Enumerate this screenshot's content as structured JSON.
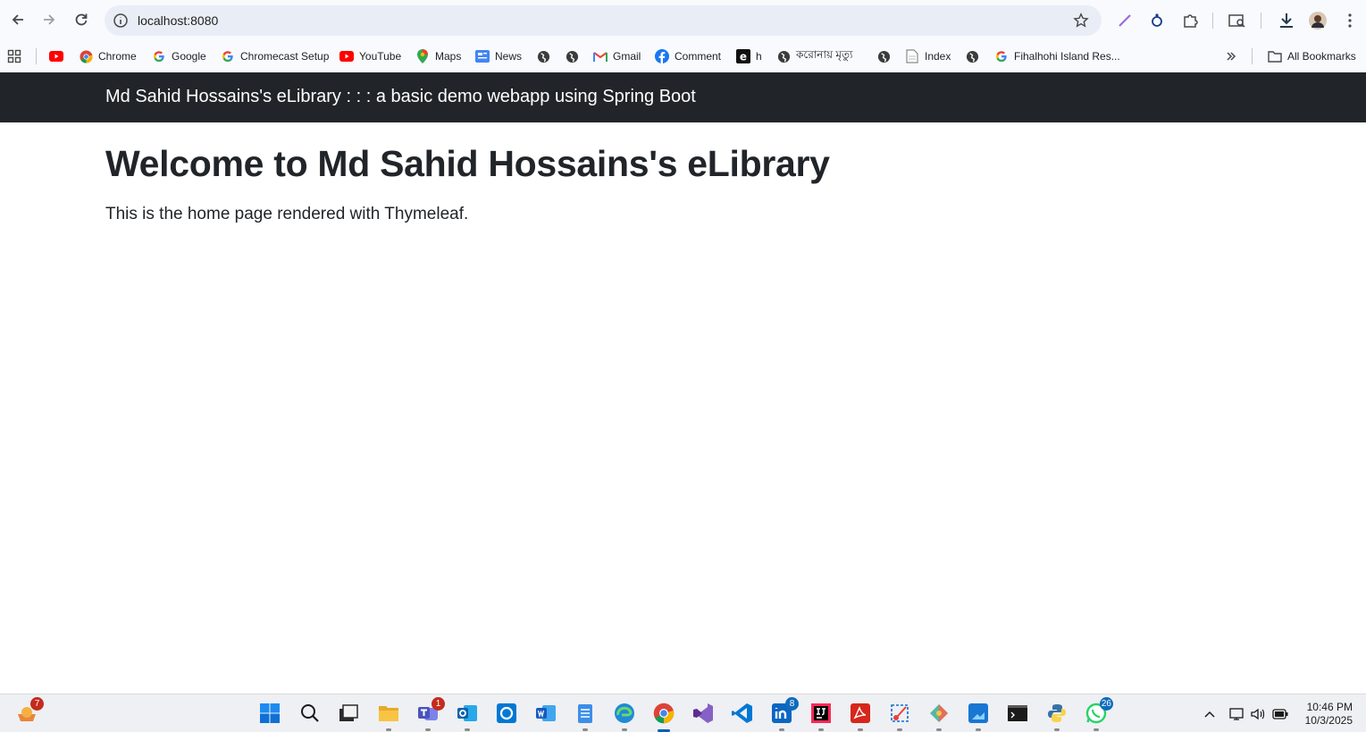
{
  "browser": {
    "url": "localhost:8080",
    "bookmarks": [
      {
        "label": "",
        "icon": "youtube-icon"
      },
      {
        "label": "Chrome",
        "icon": "chrome-icon"
      },
      {
        "label": "Google",
        "icon": "google-icon"
      },
      {
        "label": "Chromecast Setup",
        "icon": "google-icon"
      },
      {
        "label": "YouTube",
        "icon": "youtube-icon"
      },
      {
        "label": "Maps",
        "icon": "maps-icon"
      },
      {
        "label": "News",
        "icon": "news-icon"
      },
      {
        "label": "",
        "icon": "globe-icon"
      },
      {
        "label": "",
        "icon": "globe-icon"
      },
      {
        "label": "Gmail",
        "icon": "gmail-icon"
      },
      {
        "label": "Comment",
        "icon": "facebook-icon"
      },
      {
        "label": "h",
        "icon": "e-icon"
      },
      {
        "label": "করোনায় মৃত্যু",
        "icon": "globe-icon"
      },
      {
        "label": "",
        "icon": "globe-icon"
      },
      {
        "label": "Index",
        "icon": "doc-icon"
      },
      {
        "label": "",
        "icon": "globe-icon"
      },
      {
        "label": "Fihalhohi Island Res...",
        "icon": "google-icon"
      }
    ],
    "all_bookmarks": "All Bookmarks"
  },
  "page": {
    "brand": "Md Sahid Hossains's eLibrary : : : a basic demo webapp using Spring Boot",
    "heading": "Welcome to Md Sahid Hossains's eLibrary",
    "lead": "This is the home page rendered with Thymeleaf."
  },
  "taskbar": {
    "notifications_badge": "7",
    "teams_badge": "1",
    "linkedin_badge": "8",
    "whatsapp_badge": "26",
    "time": "10:46 PM",
    "date": "10/3/2025"
  },
  "colors": {
    "navbar": "#212529",
    "omnibox": "#e9eef6",
    "badge_red": "#c42b1c",
    "badge_blue": "#0f6cbd"
  }
}
